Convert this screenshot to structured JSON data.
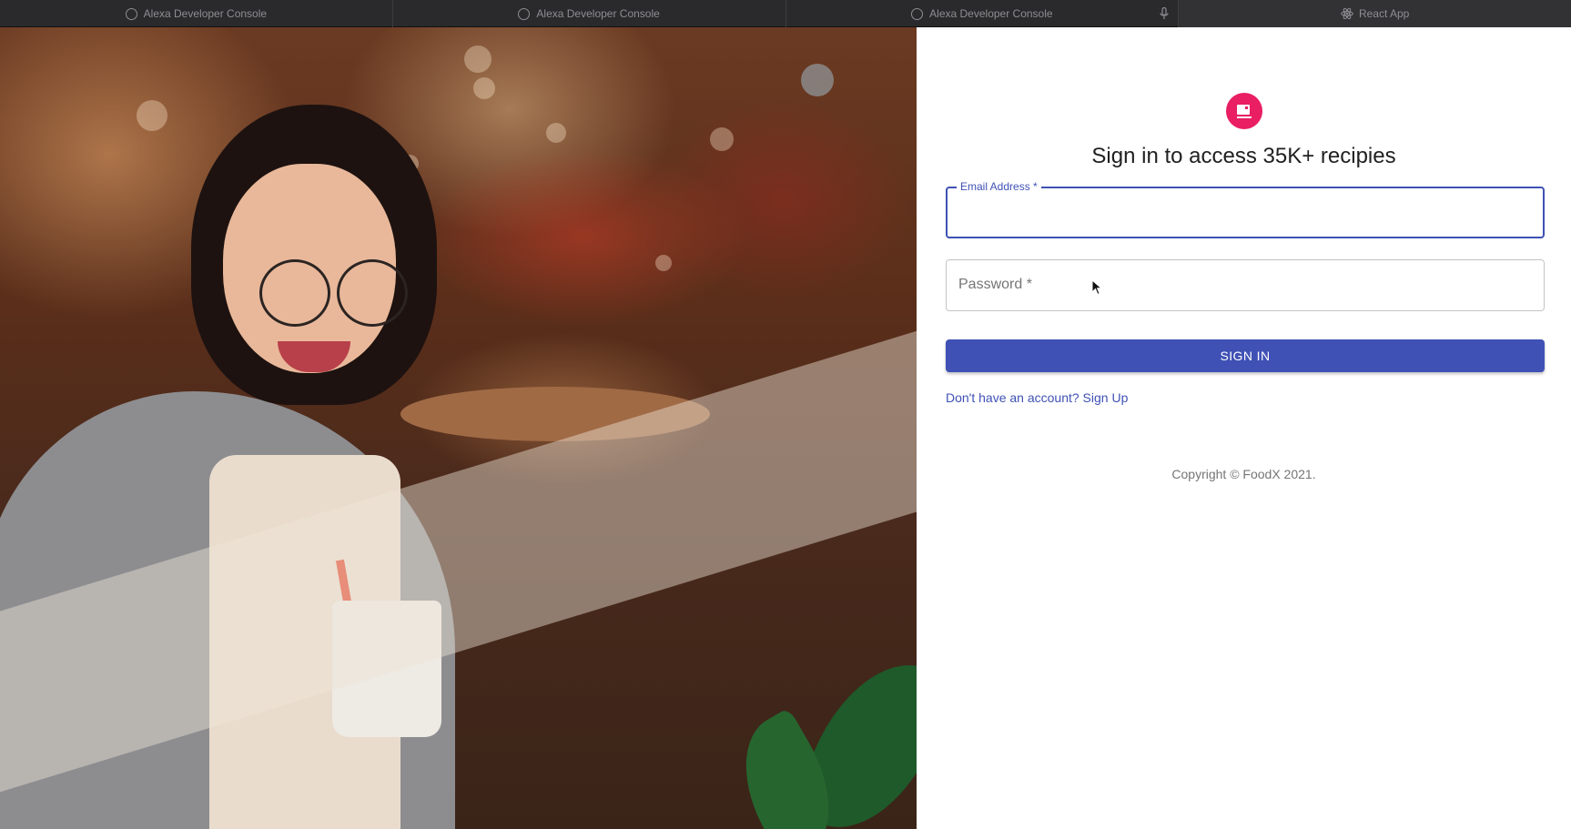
{
  "browser": {
    "tabs": [
      {
        "label": "Alexa Developer Console",
        "icon": "loading-circle-icon"
      },
      {
        "label": "Alexa Developer Console",
        "icon": "loading-circle-icon"
      },
      {
        "label": "Alexa Developer Console",
        "icon": "loading-circle-icon",
        "extra_icon": "microphone-icon"
      },
      {
        "label": "React App",
        "icon": "react-logo-icon"
      }
    ]
  },
  "hero_image": {
    "subject": "smiling woman with glasses holding a cup in a cafe"
  },
  "signin": {
    "logo_icon": "cup-icon",
    "logo_color": "#e91e63",
    "title": "Sign in to access 35K+ recipies",
    "email": {
      "label": "Email Address *",
      "value": ""
    },
    "password": {
      "label": "Password *",
      "value": ""
    },
    "submit_label": "SIGN IN",
    "signup_link": "Don't have an account? Sign Up",
    "copyright": "Copyright © FoodX 2021."
  },
  "colors": {
    "primary": "#3f51b5",
    "accent": "#e91e63"
  }
}
